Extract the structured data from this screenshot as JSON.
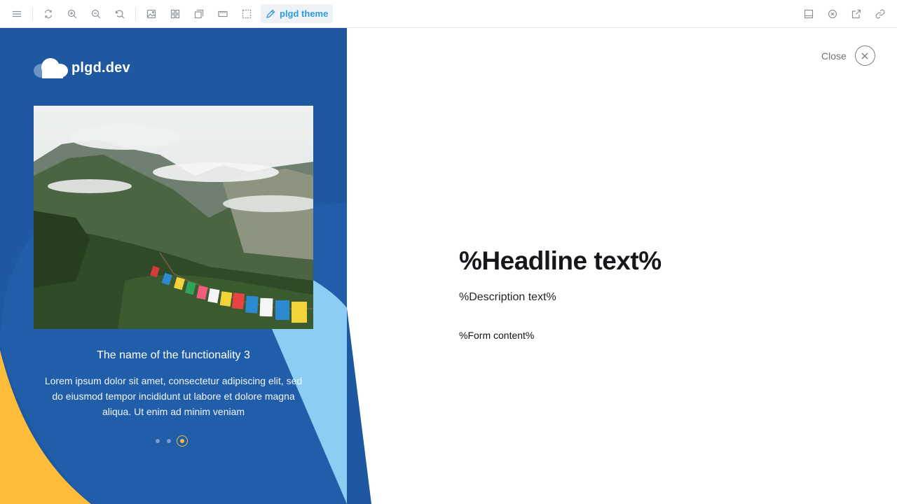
{
  "toolbar": {
    "theme_label": "plgd theme",
    "icons_left": [
      "menu-icon",
      "refresh-icon",
      "zoom-in-icon",
      "zoom-out-icon",
      "reset-zoom-icon",
      "image-icon",
      "grid-icon",
      "layers-icon",
      "ruler-icon",
      "selection-icon"
    ],
    "icons_right": [
      "layout-icon",
      "close-circle-icon",
      "external-link-icon",
      "link-icon"
    ]
  },
  "brand": {
    "name": "plgd.dev"
  },
  "feature": {
    "title": "The name of the functionality 3",
    "description": "Lorem ipsum dolor sit amet, consectetur adipiscing elit, sed do eiusmod tempor incididunt ut labore et dolore magna aliqua. Ut enim ad minim veniam",
    "slide_count": 3,
    "active_slide": 3
  },
  "close": {
    "label": "Close"
  },
  "main": {
    "headline": "%Headline text%",
    "description": "%Description text%",
    "form": "%Form content%"
  },
  "colors": {
    "panel_blue": "#1e58a0",
    "light_blue": "#8ccdf3",
    "yellow": "#fdbd3b",
    "accent": "#2e9bd9"
  }
}
